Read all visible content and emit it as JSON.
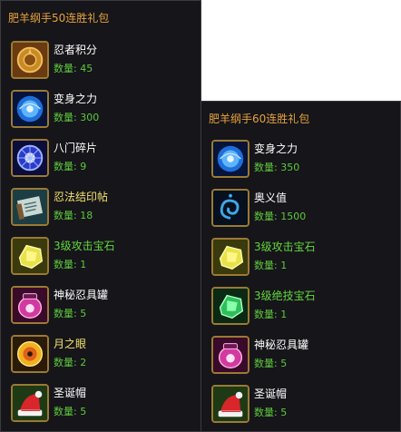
{
  "colors": {
    "orange_title": "#e8a23a",
    "green_qty": "#5ec93a",
    "panel_bg": "#15151a",
    "icon_border": "#9a7a34"
  },
  "panel_a": {
    "title": "肥羊纲手50连胜礼包",
    "qty_label": "数量:",
    "items": [
      {
        "name": "忍者积分",
        "qty": "45",
        "icon": "ninja-points-medallion-icon",
        "name_color": "white"
      },
      {
        "name": "变身之力",
        "qty": "300",
        "icon": "transform-power-orb-icon",
        "name_color": "white"
      },
      {
        "name": "八门碎片",
        "qty": "9",
        "icon": "eight-gates-fragment-icon",
        "name_color": "white"
      },
      {
        "name": "忍法结印帖",
        "qty": "18",
        "icon": "ninja-seal-scroll-icon",
        "name_color": "yellow"
      },
      {
        "name": "3级攻击宝石",
        "qty": "1",
        "icon": "yellow-attack-gem-icon",
        "name_color": "green"
      },
      {
        "name": "神秘忍具罐",
        "qty": "5",
        "icon": "mystery-tool-jar-icon",
        "name_color": "white"
      },
      {
        "name": "月之眼",
        "qty": "2",
        "icon": "moon-eye-icon",
        "name_color": "yellow"
      },
      {
        "name": "圣诞帽",
        "qty": "5",
        "icon": "christmas-hat-icon",
        "name_color": "white"
      }
    ]
  },
  "panel_b": {
    "title": "肥羊纲手60连胜礼包",
    "qty_label": "数量:",
    "items": [
      {
        "name": "变身之力",
        "qty": "350",
        "icon": "transform-power-orb-icon",
        "name_color": "white"
      },
      {
        "name": "奥义值",
        "qty": "1500",
        "icon": "mystery-swirl-icon",
        "name_color": "white"
      },
      {
        "name": "3级攻击宝石",
        "qty": "1",
        "icon": "yellow-attack-gem-icon",
        "name_color": "green"
      },
      {
        "name": "3级绝技宝石",
        "qty": "1",
        "icon": "green-skill-gem-icon",
        "name_color": "green"
      },
      {
        "name": "神秘忍具罐",
        "qty": "5",
        "icon": "mystery-tool-jar-icon",
        "name_color": "white"
      },
      {
        "name": "圣诞帽",
        "qty": "5",
        "icon": "christmas-hat-icon",
        "name_color": "white"
      }
    ]
  }
}
